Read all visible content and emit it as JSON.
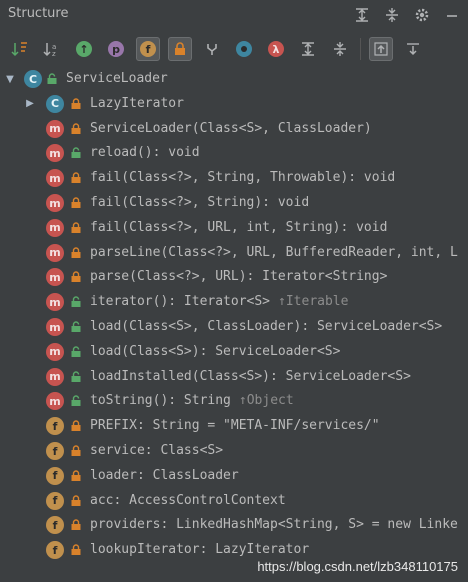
{
  "header": {
    "title": "Structure"
  },
  "tree": {
    "root": {
      "label": "ServiceLoader"
    },
    "items": [
      {
        "label": "LazyIterator",
        "kind": "class",
        "access": "private"
      },
      {
        "label": "ServiceLoader(Class<S>, ClassLoader)",
        "kind": "method",
        "access": "private"
      },
      {
        "label": "reload(): void",
        "kind": "method",
        "access": "public"
      },
      {
        "label": "fail(Class<?>, String, Throwable): void",
        "kind": "method",
        "access": "private"
      },
      {
        "label": "fail(Class<?>, String): void",
        "kind": "method",
        "access": "private"
      },
      {
        "label": "fail(Class<?>, URL, int, String): void",
        "kind": "method",
        "access": "private"
      },
      {
        "label": "parseLine(Class<?>, URL, BufferedReader, int, L",
        "kind": "method",
        "access": "private"
      },
      {
        "label": "parse(Class<?>, URL): Iterator<String>",
        "kind": "method",
        "access": "private"
      },
      {
        "label": "iterator(): Iterator<S>",
        "hint": "↑Iterable",
        "kind": "method",
        "access": "public"
      },
      {
        "label": "load(Class<S>, ClassLoader): ServiceLoader<S>",
        "kind": "method",
        "access": "public"
      },
      {
        "label": "load(Class<S>): ServiceLoader<S>",
        "kind": "method",
        "access": "public"
      },
      {
        "label": "loadInstalled(Class<S>): ServiceLoader<S>",
        "kind": "method",
        "access": "public"
      },
      {
        "label": "toString(): String",
        "hint": "↑Object",
        "kind": "method",
        "access": "public"
      },
      {
        "label": "PREFIX: String = \"META-INF/services/\"",
        "kind": "field",
        "access": "private"
      },
      {
        "label": "service: Class<S>",
        "kind": "field",
        "access": "private"
      },
      {
        "label": "loader: ClassLoader",
        "kind": "field",
        "access": "private"
      },
      {
        "label": "acc: AccessControlContext",
        "kind": "field",
        "access": "private"
      },
      {
        "label": "providers: LinkedHashMap<String, S> = new Linke",
        "kind": "field",
        "access": "private"
      },
      {
        "label": "lookupIterator: LazyIterator",
        "kind": "field",
        "access": "private"
      }
    ]
  },
  "watermark": "https://blog.csdn.net/lzb348110175",
  "colors": {
    "background": "#3c3f41",
    "class_icon": "#3e86a0",
    "method_icon": "#c75450",
    "field_icon": "#c0904d",
    "lock_private": "#d9822b",
    "lock_public": "#59a869"
  }
}
